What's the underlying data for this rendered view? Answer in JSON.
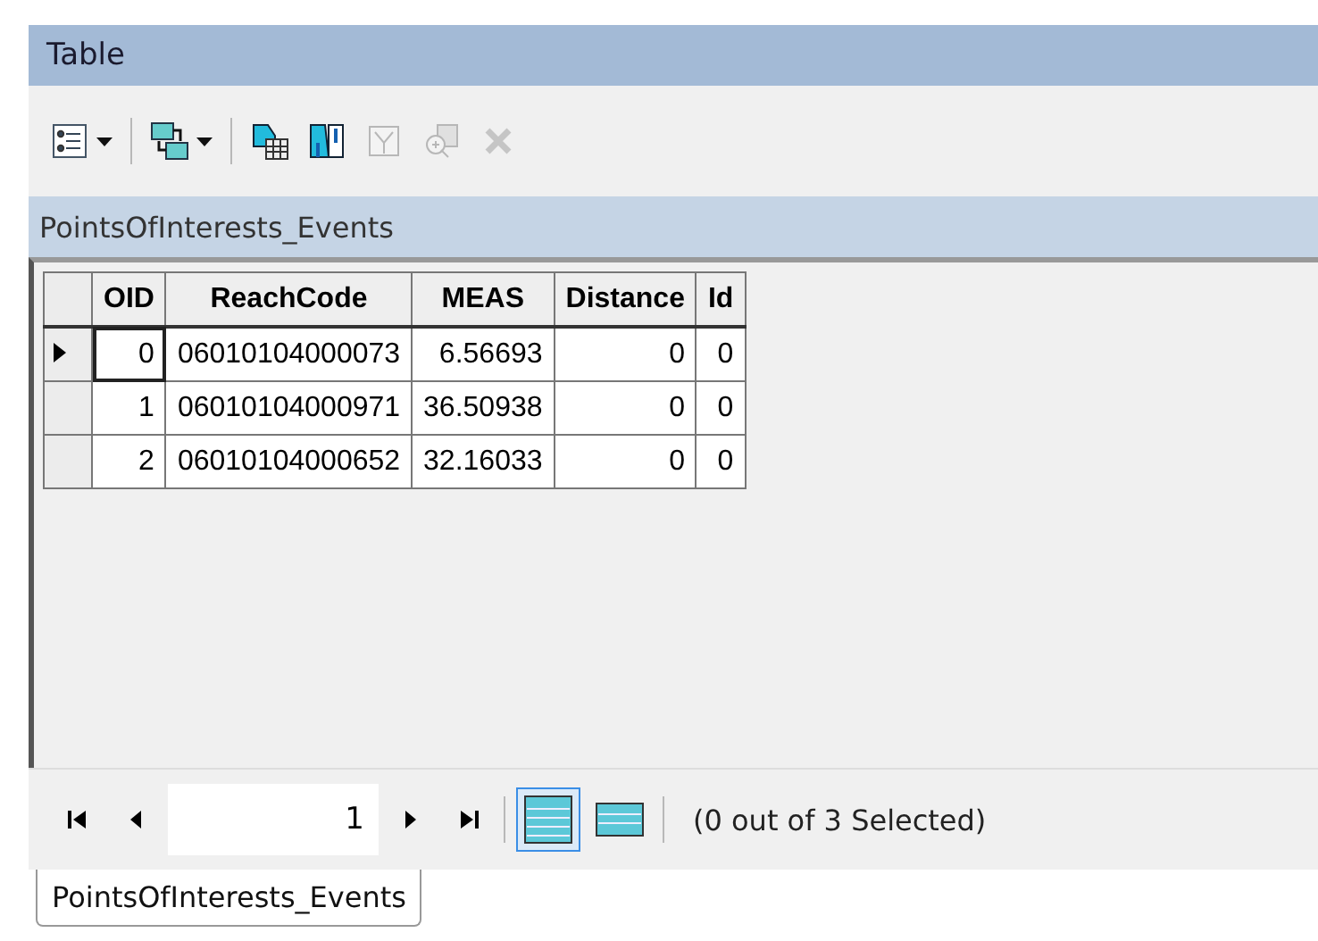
{
  "window": {
    "title": "Table"
  },
  "toolbar": {
    "buttons": [
      {
        "kind": "options",
        "disabled": false,
        "dropdown": true
      },
      {
        "kind": "relate",
        "disabled": false,
        "dropdown": true
      },
      {
        "kind": "select-by",
        "disabled": false,
        "dropdown": false
      },
      {
        "kind": "switch",
        "disabled": false,
        "dropdown": false
      },
      {
        "kind": "clear",
        "disabled": true,
        "dropdown": false
      },
      {
        "kind": "zoom",
        "disabled": true,
        "dropdown": false
      },
      {
        "kind": "delete",
        "disabled": true,
        "dropdown": false
      }
    ]
  },
  "table_name": "PointsOfInterests_Events",
  "table": {
    "columns": [
      {
        "label": "OID",
        "kind": "number"
      },
      {
        "label": "ReachCode",
        "kind": "text"
      },
      {
        "label": "MEAS",
        "kind": "number"
      },
      {
        "label": "Distance",
        "kind": "number"
      },
      {
        "label": "Id",
        "kind": "number"
      }
    ],
    "rows": [
      {
        "current": true,
        "cells": [
          "0",
          "06010104000073",
          "6.56693",
          "0",
          "0"
        ]
      },
      {
        "current": false,
        "cells": [
          "1",
          "06010104000971",
          "36.50938",
          "0",
          "0"
        ]
      },
      {
        "current": false,
        "cells": [
          "2",
          "06010104000652",
          "32.16033",
          "0",
          "0"
        ]
      }
    ]
  },
  "navigation": {
    "record": "1",
    "views": [
      {
        "kind": "all",
        "selected": true
      },
      {
        "kind": "selected",
        "selected": false
      }
    ],
    "status": "(0 out of 3 Selected)"
  },
  "tabs": [
    {
      "label": "PointsOfInterests_Events",
      "selected": true
    }
  ]
}
